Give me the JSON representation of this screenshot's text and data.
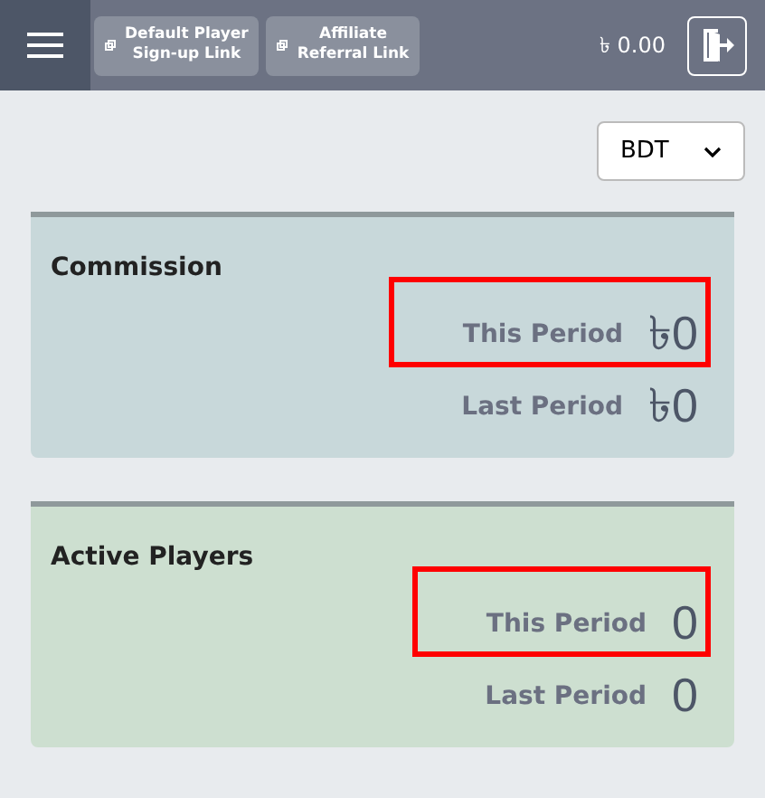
{
  "header": {
    "links": [
      {
        "label_line_1": "Default Player",
        "label_line_2": "Sign-up Link"
      },
      {
        "label_line_1": "Affiliate",
        "label_line_2": "Referral Link"
      }
    ],
    "balance": "৳ 0.00"
  },
  "currency_select": {
    "value": "BDT"
  },
  "cards": [
    {
      "title": "Commission",
      "kind": "commission",
      "stats": [
        {
          "label": "This Period",
          "value": "৳0",
          "highlighted": true
        },
        {
          "label": "Last Period",
          "value": "৳0",
          "highlighted": false
        }
      ]
    },
    {
      "title": "Active Players",
      "kind": "players",
      "stats": [
        {
          "label": "This Period",
          "value": "0",
          "highlighted": true
        },
        {
          "label": "Last Period",
          "value": "0",
          "highlighted": false
        }
      ]
    }
  ]
}
